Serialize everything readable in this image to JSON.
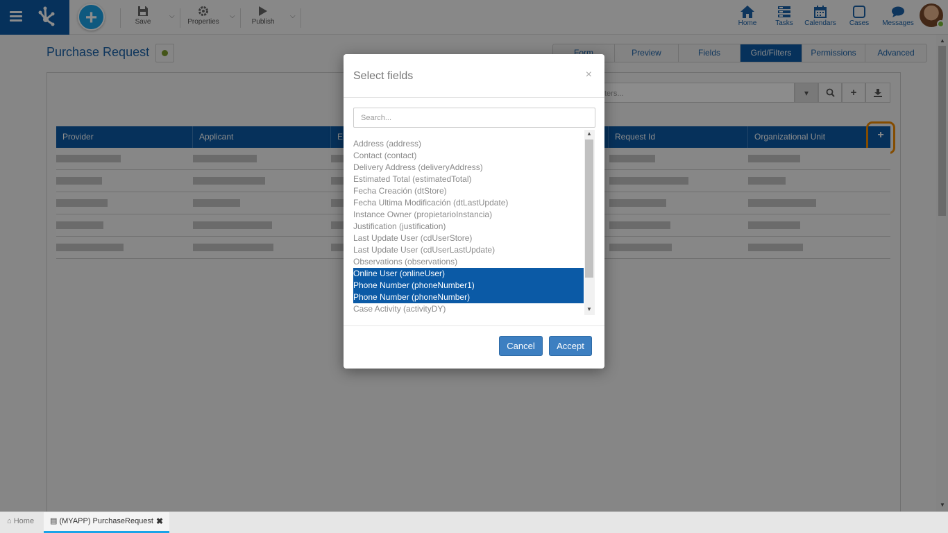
{
  "toolbar": {
    "save": "Save",
    "properties": "Properties",
    "publish": "Publish"
  },
  "nav": [
    {
      "label": "Home",
      "icon": "home-icon"
    },
    {
      "label": "Tasks",
      "icon": "tasks-icon"
    },
    {
      "label": "Calendars",
      "icon": "calendar-icon"
    },
    {
      "label": "Cases",
      "icon": "cases-icon"
    },
    {
      "label": "Messages",
      "icon": "messages-icon"
    }
  ],
  "page": {
    "title": "Purchase Request"
  },
  "tabs": [
    {
      "label": "Form"
    },
    {
      "label": "Preview"
    },
    {
      "label": "Fields"
    },
    {
      "label": "Grid/Filters",
      "active": true
    },
    {
      "label": "Permissions"
    },
    {
      "label": "Advanced"
    }
  ],
  "filter": {
    "placeholder": "ters..."
  },
  "grid": {
    "columns": [
      "Provider",
      "Applicant",
      "E",
      "Request Id",
      "Organizational Unit"
    ],
    "add_column": "+"
  },
  "modal": {
    "title": "Select fields",
    "close": "×",
    "search_placeholder": "Search...",
    "fields": [
      {
        "label": "Address (address)",
        "selected": false
      },
      {
        "label": "Contact (contact)",
        "selected": false
      },
      {
        "label": "Delivery Address (deliveryAddress)",
        "selected": false
      },
      {
        "label": "Estimated Total (estimatedTotal)",
        "selected": false
      },
      {
        "label": "Fecha Creación (dtStore)",
        "selected": false
      },
      {
        "label": "Fecha Ultima Modificación (dtLastUpdate)",
        "selected": false
      },
      {
        "label": "Instance Owner (propietarioInstancia)",
        "selected": false
      },
      {
        "label": "Justification (justification)",
        "selected": false
      },
      {
        "label": "Last Update User (cdUserStore)",
        "selected": false
      },
      {
        "label": "Last Update User (cdUserLastUpdate)",
        "selected": false
      },
      {
        "label": "Observations (observations)",
        "selected": false
      },
      {
        "label": "Online User (onlineUser)",
        "selected": true
      },
      {
        "label": "Phone Number (phoneNumber1)",
        "selected": true
      },
      {
        "label": "Phone Number (phoneNumber)",
        "selected": true
      },
      {
        "label": "Case Activity (activityDY)",
        "selected": false
      }
    ],
    "cancel": "Cancel",
    "accept": "Accept"
  },
  "taskbar": {
    "home": "Home",
    "tab": "(MYAPP) PurchaseRequest",
    "close": "✖"
  },
  "colors": {
    "primary": "#0b5aa6",
    "add_button": "#1aa3e8",
    "highlight": "#f08a00",
    "status_dot": "#7d9c2c"
  }
}
